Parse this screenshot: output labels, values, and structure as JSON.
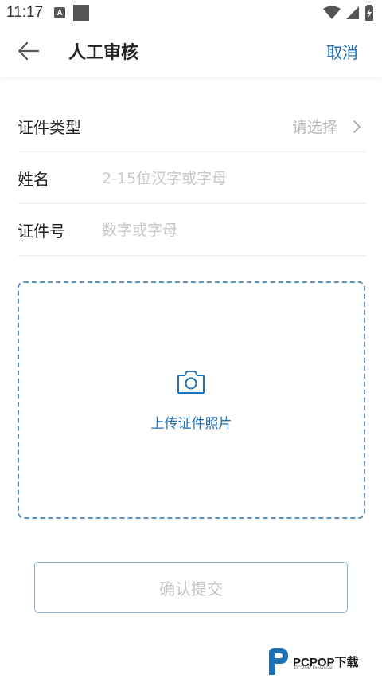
{
  "status_bar": {
    "time": "11:17",
    "notification_icon": "A"
  },
  "app_bar": {
    "title": "人工审核",
    "cancel_label": "取消"
  },
  "form": {
    "id_type": {
      "label": "证件类型",
      "value": "请选择"
    },
    "name": {
      "label": "姓名",
      "placeholder": "2-15位汉字或字母"
    },
    "id_number": {
      "label": "证件号",
      "placeholder": "数字或字母"
    }
  },
  "upload": {
    "label": "上传证件照片"
  },
  "confirm_label": "确认提交",
  "watermark": {
    "brand": "PCPOP下载",
    "sub": "PCPOP Download"
  },
  "colors": {
    "accent": "#1f6fb5",
    "dashed_border": "#5a8fc2",
    "placeholder": "#c8c8c8"
  }
}
